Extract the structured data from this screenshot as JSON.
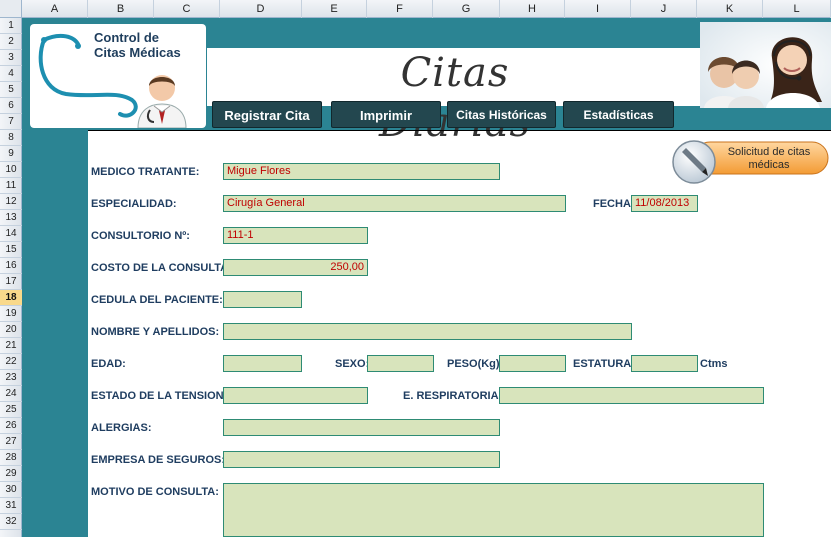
{
  "sheet": {
    "columns": [
      "A",
      "B",
      "C",
      "D",
      "E",
      "F",
      "G",
      "H",
      "I",
      "J",
      "K",
      "L"
    ],
    "rows": [
      "1",
      "2",
      "3",
      "4",
      "5",
      "6",
      "7",
      "8",
      "9",
      "10",
      "11",
      "12",
      "13",
      "14",
      "15",
      "16",
      "17",
      "18",
      "19",
      "20",
      "21",
      "22",
      "23",
      "24",
      "25",
      "26",
      "27",
      "28",
      "29",
      "30",
      "31",
      "32"
    ],
    "selected_row": "18"
  },
  "header": {
    "logo_line1": "Control de",
    "logo_line2": "Citas Médicas",
    "title": "Citas Diarias"
  },
  "nav": {
    "registrar": "Registrar Cita",
    "imprimir": "Imprimir",
    "historicas": "Citas Históricas",
    "estadisticas": "Estadísticas"
  },
  "solicitud": {
    "line1": "Solicitud de citas",
    "line2": "médicas"
  },
  "form": {
    "medico_label": "MEDICO TRATANTE:",
    "medico_value": "Migue Flores",
    "especialidad_label": "ESPECIALIDAD:",
    "especialidad_value": "Cirugía General",
    "fecha_label": "FECHA:",
    "fecha_value": "11/08/2013",
    "consultorio_label": "CONSULTORIO Nº:",
    "consultorio_value": "111-1",
    "costo_label": "COSTO DE LA CONSULTA:",
    "costo_value": "250,00",
    "cedula_label": "CEDULA DEL PACIENTE:",
    "cedula_value": "",
    "nombre_label": "NOMBRE Y APELLIDOS:",
    "nombre_value": "",
    "edad_label": "EDAD:",
    "edad_value": "",
    "sexo_label": "SEXO:",
    "sexo_value": "",
    "peso_label": "PESO(Kg):",
    "peso_value": "",
    "estatura_label": "ESTATURA:",
    "estatura_value": "",
    "estatura_unit": "Ctms",
    "tension_label": "ESTADO DE LA TENSION:",
    "tension_value": "",
    "respiratorias_label": "E. RESPIRATORIAS:",
    "respiratorias_value": "",
    "alergias_label": "ALERGIAS:",
    "alergias_value": "",
    "seguros_label": "EMPRESA DE SEGUROS:",
    "seguros_value": "",
    "motivo_label": "MOTIVO DE CONSULTA:",
    "motivo_value": ""
  },
  "colors": {
    "teal": "#2b8493",
    "button_dark": "#23474f",
    "field_fill": "#d8e4bc",
    "field_border": "#2e8b74",
    "value_red": "#c00000",
    "label_blue": "#1f3d60"
  },
  "icons": {
    "logo": "stethoscope-icon",
    "doctor": "doctor-icon",
    "photo": "headset-operators-photo",
    "solicitud": "pen-icon"
  }
}
